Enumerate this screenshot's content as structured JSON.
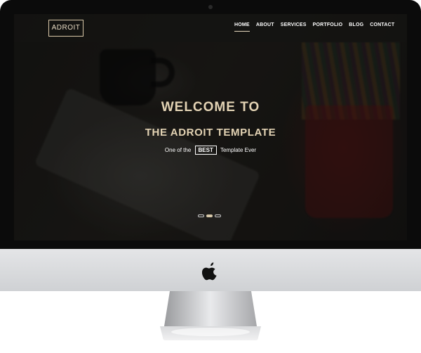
{
  "logo": {
    "text": "ADROIT"
  },
  "nav": {
    "items": [
      {
        "label": "HOME",
        "active": true
      },
      {
        "label": "ABOUT"
      },
      {
        "label": "SERVICES"
      },
      {
        "label": "PORTFOLIO"
      },
      {
        "label": "BLOG"
      },
      {
        "label": "CONTACT"
      }
    ]
  },
  "hero": {
    "title": "WELCOME TO",
    "subtitle": "THE ADROIT TEMPLATE",
    "tagline_before": "One of the",
    "tagline_badge": "BEST",
    "tagline_after": "Template Ever"
  },
  "slider": {
    "dots": 3,
    "active_index": 1
  },
  "device": {
    "icon": "apple-logo-icon"
  },
  "colors": {
    "accent": "#e3d3b4",
    "nav_text": "#ffffff",
    "bezel": "#0b0b0b",
    "chin": "#d8d9dc"
  }
}
